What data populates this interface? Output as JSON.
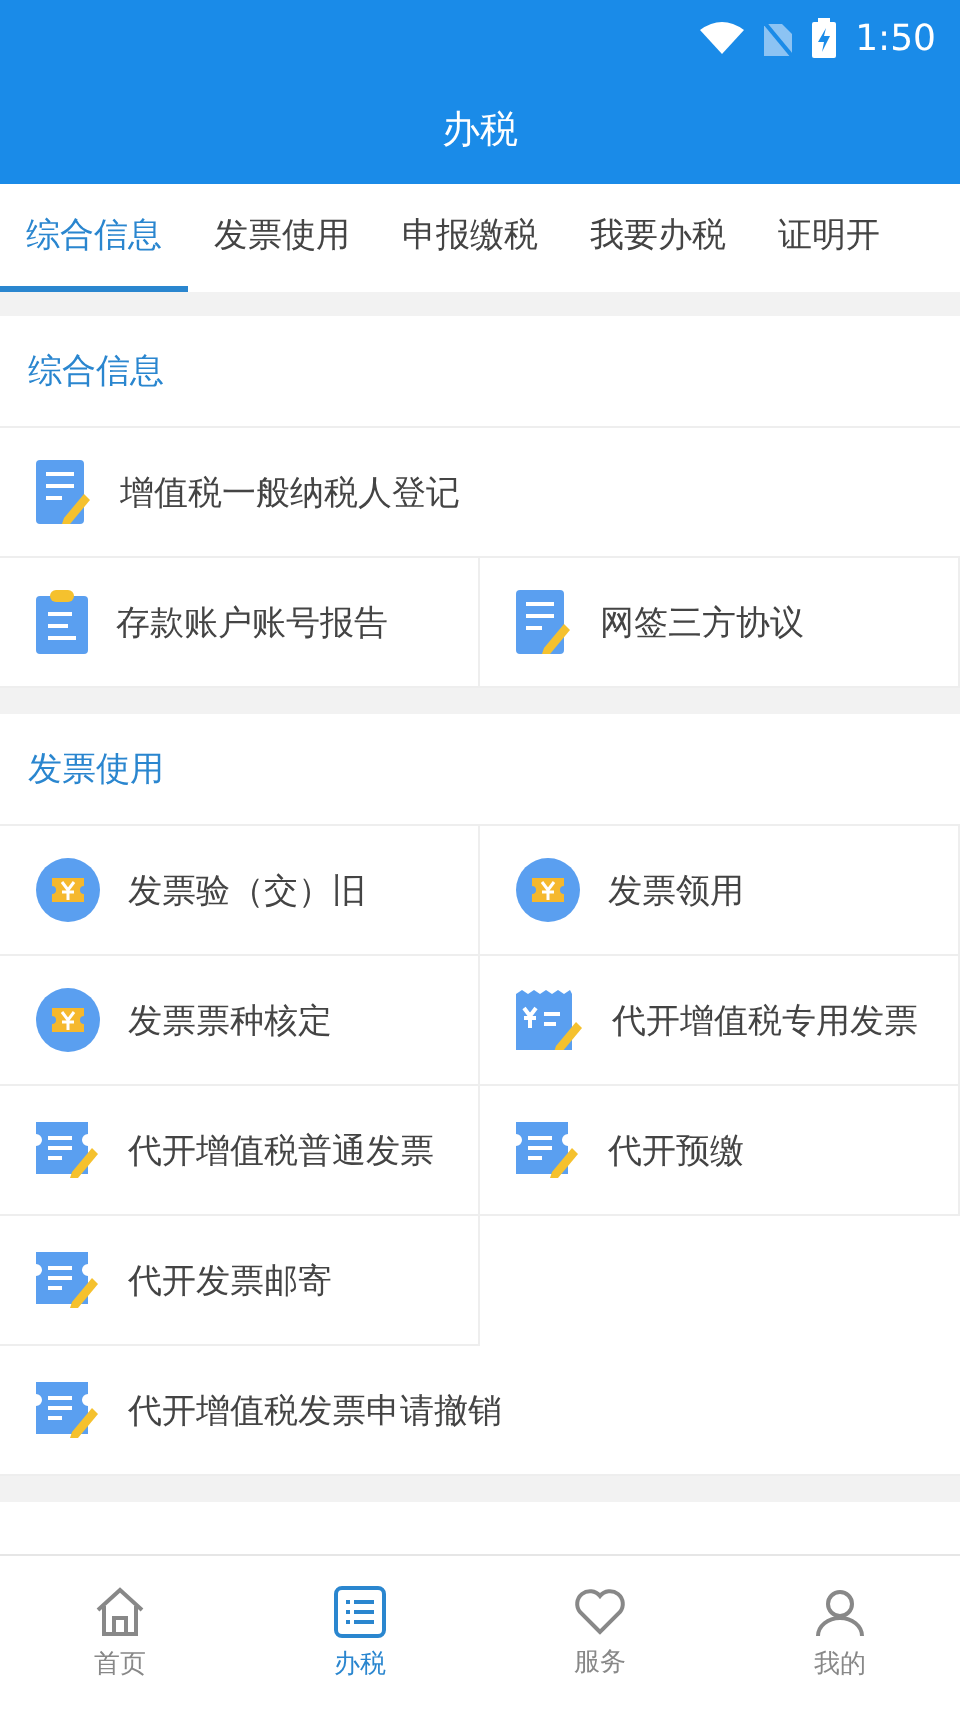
{
  "status_bar": {
    "time": "1:50"
  },
  "title": "办税",
  "tabs": [
    {
      "label": "综合信息",
      "selected": true
    },
    {
      "label": "发票使用",
      "selected": false
    },
    {
      "label": "申报缴税",
      "selected": false
    },
    {
      "label": "我要办税",
      "selected": false
    },
    {
      "label": "证明开",
      "selected": false
    }
  ],
  "sections": [
    {
      "title": "综合信息",
      "items": [
        {
          "label": "增值税一般纳税人登记",
          "kind": "doc-pen",
          "wide": true
        },
        {
          "label": "存款账户账号报告",
          "kind": "clipboard",
          "wide": false
        },
        {
          "label": "网签三方协议",
          "kind": "doc-pen",
          "wide": false
        }
      ]
    },
    {
      "title": "发票使用",
      "items": [
        {
          "label": "发票验（交）旧",
          "kind": "ticket-coin",
          "wide": false
        },
        {
          "label": "发票领用",
          "kind": "ticket-coin",
          "wide": false
        },
        {
          "label": "发票票种核定",
          "kind": "ticket-coin",
          "wide": false
        },
        {
          "label": "代开增值税专用发票",
          "kind": "yen-receipt",
          "wide": false
        },
        {
          "label": "代开增值税普通发票",
          "kind": "receipt-pen",
          "wide": false
        },
        {
          "label": "代开预缴",
          "kind": "receipt-pen",
          "wide": false
        },
        {
          "label": "代开发票邮寄",
          "kind": "receipt-pen",
          "wide": false
        },
        {
          "label": "代开增值税发票申请撤销",
          "kind": "receipt-pen",
          "wide": true
        }
      ]
    },
    {
      "kind": "cut"
    }
  ],
  "bottom_nav": [
    {
      "label": "首页",
      "kind": "home",
      "selected": false
    },
    {
      "label": "办税",
      "kind": "list",
      "selected": true
    },
    {
      "label": "服务",
      "kind": "heart",
      "selected": false
    },
    {
      "label": "我的",
      "kind": "person",
      "selected": false
    }
  ]
}
